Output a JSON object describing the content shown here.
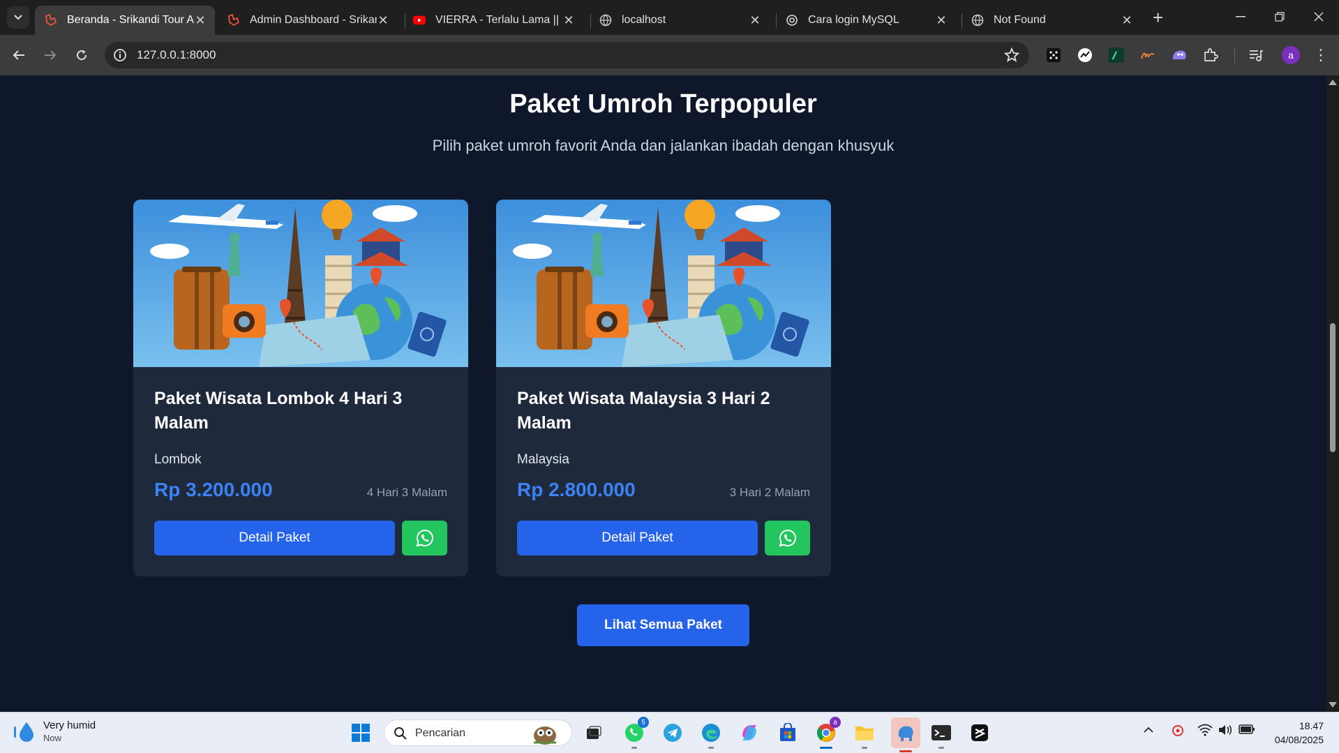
{
  "browser": {
    "tabs": [
      {
        "title": "Beranda - Srikandi Tour And Travel",
        "active": true,
        "icon": "laravel-icon"
      },
      {
        "title": "Admin Dashboard - Srikandi",
        "active": false,
        "icon": "laravel-icon"
      },
      {
        "title": "VIERRA - Terlalu Lama || Lirik",
        "active": false,
        "icon": "youtube-icon"
      },
      {
        "title": "localhost",
        "active": false,
        "icon": "globe-icon"
      },
      {
        "title": "Cara login MySQL",
        "active": false,
        "icon": "chatgpt-icon"
      },
      {
        "title": "Not Found",
        "active": false,
        "icon": "globe-icon"
      }
    ],
    "url": "127.0.0.1:8000",
    "profile_initial": "a"
  },
  "section": {
    "title": "Paket Umroh Terpopuler",
    "subtitle": "Pilih paket umroh favorit Anda dan jalankan ibadah dengan khusyuk"
  },
  "packages": [
    {
      "name": "Paket Wisata Lombok 4 Hari 3 Malam",
      "location": "Lombok",
      "price": "Rp 3.200.000",
      "duration": "4 Hari 3 Malam",
      "detail_label": "Detail Paket"
    },
    {
      "name": "Paket Wisata Malaysia 3 Hari 2 Malam",
      "location": "Malaysia",
      "price": "Rp 2.800.000",
      "duration": "3 Hari 2 Malam",
      "detail_label": "Detail Paket"
    }
  ],
  "all_packages_label": "Lihat Semua Paket",
  "colors": {
    "page_bg": "#0f172a",
    "card_bg": "#1e293b",
    "primary": "#2563eb",
    "price": "#3b82f6",
    "whatsapp": "#22c55e"
  },
  "taskbar": {
    "weather_status": "Very humid",
    "weather_time": "Now",
    "search_placeholder": "Pencarian",
    "whatsapp_badge": "5",
    "time": "18.47",
    "date": "04/08/2025"
  }
}
